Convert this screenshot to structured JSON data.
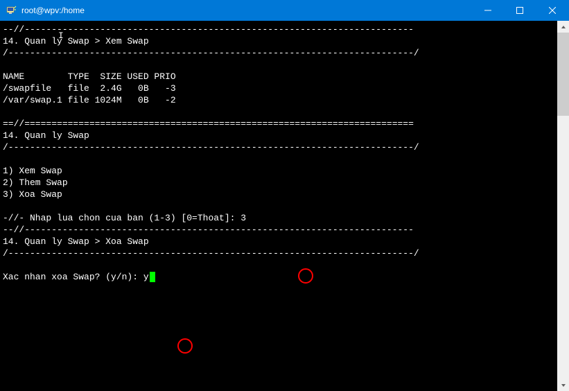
{
  "titlebar": {
    "title": "root@wpv:/home"
  },
  "terminal": {
    "sep_top": "--//------------------------------------------------------------------------",
    "crumb1": "14. Quan ly Swap > Xem Swap",
    "sep_dash": "/---------------------------------------------------------------------------/",
    "blank": "",
    "table": {
      "header": "NAME        TYPE  SIZE USED PRIO",
      "row1": "/swapfile   file  2.4G   0B   -3",
      "row2": "/var/swap.1 file 1024M   0B   -2"
    },
    "sep_eq": "==//========================================================================",
    "menu_title": "14. Quan ly Swap",
    "opt1": "1) Xem Swap",
    "opt2": "2) Them Swap",
    "opt3": "3) Xoa Swap",
    "prompt_choice_pre": "-//- Nhap lua chon cua ban (1-3) [0=Thoat]: ",
    "choice_val": "3",
    "sep_top2": "--//------------------------------------------------------------------------",
    "crumb2": "14. Quan ly Swap > Xoa Swap",
    "confirm_pre": "Xac nhan xoa Swap? (y/n): ",
    "confirm_val": "y"
  }
}
